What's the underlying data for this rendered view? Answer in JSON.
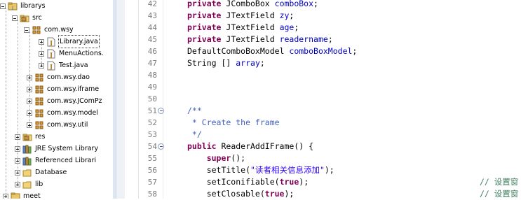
{
  "explorer": {
    "items": [
      {
        "label": "librarys",
        "icon": "project-icon",
        "expanded": true
      },
      {
        "label": "src",
        "icon": "source-folder-icon",
        "expanded": true
      },
      {
        "label": "com.wsy",
        "icon": "package-icon",
        "expanded": true
      },
      {
        "label": "Library.java",
        "icon": "java-file-icon",
        "expanded": false
      },
      {
        "label": "MenuActions.",
        "icon": "java-file-icon",
        "expanded": false
      },
      {
        "label": "Test.java",
        "icon": "java-file-icon",
        "expanded": false
      },
      {
        "label": "com.wsy.dao",
        "icon": "package-icon",
        "expanded": false
      },
      {
        "label": "com.wsy.iframe",
        "icon": "package-icon",
        "expanded": false
      },
      {
        "label": "com.wsy.JComPz",
        "icon": "package-icon",
        "expanded": false
      },
      {
        "label": "com.wsy.model",
        "icon": "package-icon",
        "expanded": false
      },
      {
        "label": "com.wsy.util",
        "icon": "package-icon",
        "expanded": false
      },
      {
        "label": "res",
        "icon": "source-folder-icon",
        "expanded": false
      },
      {
        "label": "JRE System Library",
        "icon": "library-icon",
        "expanded": false
      },
      {
        "label": "Referenced Librari",
        "icon": "library-icon",
        "expanded": false
      },
      {
        "label": "Database",
        "icon": "folder-icon",
        "expanded": false
      },
      {
        "label": "lib",
        "icon": "folder-icon",
        "expanded": false
      },
      {
        "label": "meet",
        "icon": "project-icon",
        "expanded": false
      }
    ]
  },
  "editor": {
    "line_numbers": [
      "42",
      "43",
      "44",
      "45",
      "46",
      "47",
      "48",
      "49",
      "50",
      "51",
      "52",
      "53",
      "54",
      "55",
      "56",
      "57",
      "58"
    ],
    "lines": [
      {
        "parts": [
          [
            "kw",
            "private "
          ],
          [
            "",
            "JComboBox "
          ],
          [
            "fld",
            "comboBox"
          ],
          [
            "",
            ";"
          ]
        ]
      },
      {
        "parts": [
          [
            "kw",
            "private "
          ],
          [
            "",
            "JTextField "
          ],
          [
            "fld",
            "zy"
          ],
          [
            "",
            ";"
          ]
        ]
      },
      {
        "parts": [
          [
            "kw",
            "private "
          ],
          [
            "",
            "JTextField "
          ],
          [
            "fld",
            "age"
          ],
          [
            "",
            ";"
          ]
        ]
      },
      {
        "parts": [
          [
            "kw",
            "private "
          ],
          [
            "",
            "JTextField "
          ],
          [
            "fld",
            "readername"
          ],
          [
            "",
            ";"
          ]
        ]
      },
      {
        "parts": [
          [
            "",
            "DefaultComboBoxModel "
          ],
          [
            "fld",
            "comboBoxModel"
          ],
          [
            "",
            ";"
          ]
        ]
      },
      {
        "parts": [
          [
            "",
            "String [] "
          ],
          [
            "fld",
            "array"
          ],
          [
            "",
            ";"
          ]
        ]
      },
      {
        "parts": []
      },
      {
        "parts": []
      },
      {
        "parts": []
      },
      {
        "parts": [
          [
            "cmt",
            "/**"
          ]
        ]
      },
      {
        "parts": [
          [
            "cmt",
            " * Create the frame"
          ]
        ]
      },
      {
        "parts": [
          [
            "cmt",
            " */"
          ]
        ]
      },
      {
        "parts": [
          [
            "kw",
            "public "
          ],
          [
            "",
            "ReaderAddIFrame() {"
          ]
        ]
      },
      {
        "parts": [
          [
            "",
            "    "
          ],
          [
            "kw",
            "super"
          ],
          [
            "",
            "();"
          ]
        ]
      },
      {
        "parts": [
          [
            "",
            "    setTitle("
          ],
          [
            "str",
            "\"读者相关信息添加\""
          ],
          [
            "",
            ");"
          ]
        ]
      },
      {
        "parts": [
          [
            "",
            "    setIconifiable("
          ],
          [
            "kw",
            "true"
          ],
          [
            "",
            ");"
          ]
        ]
      },
      {
        "parts": [
          [
            "",
            "    setClosable("
          ],
          [
            "kw",
            "true"
          ],
          [
            "",
            ");"
          ]
        ]
      }
    ],
    "trailing_comments": [
      {
        "line": 15,
        "text": "// 设置窗"
      },
      {
        "line": 16,
        "text": "// 设置窗"
      }
    ]
  }
}
